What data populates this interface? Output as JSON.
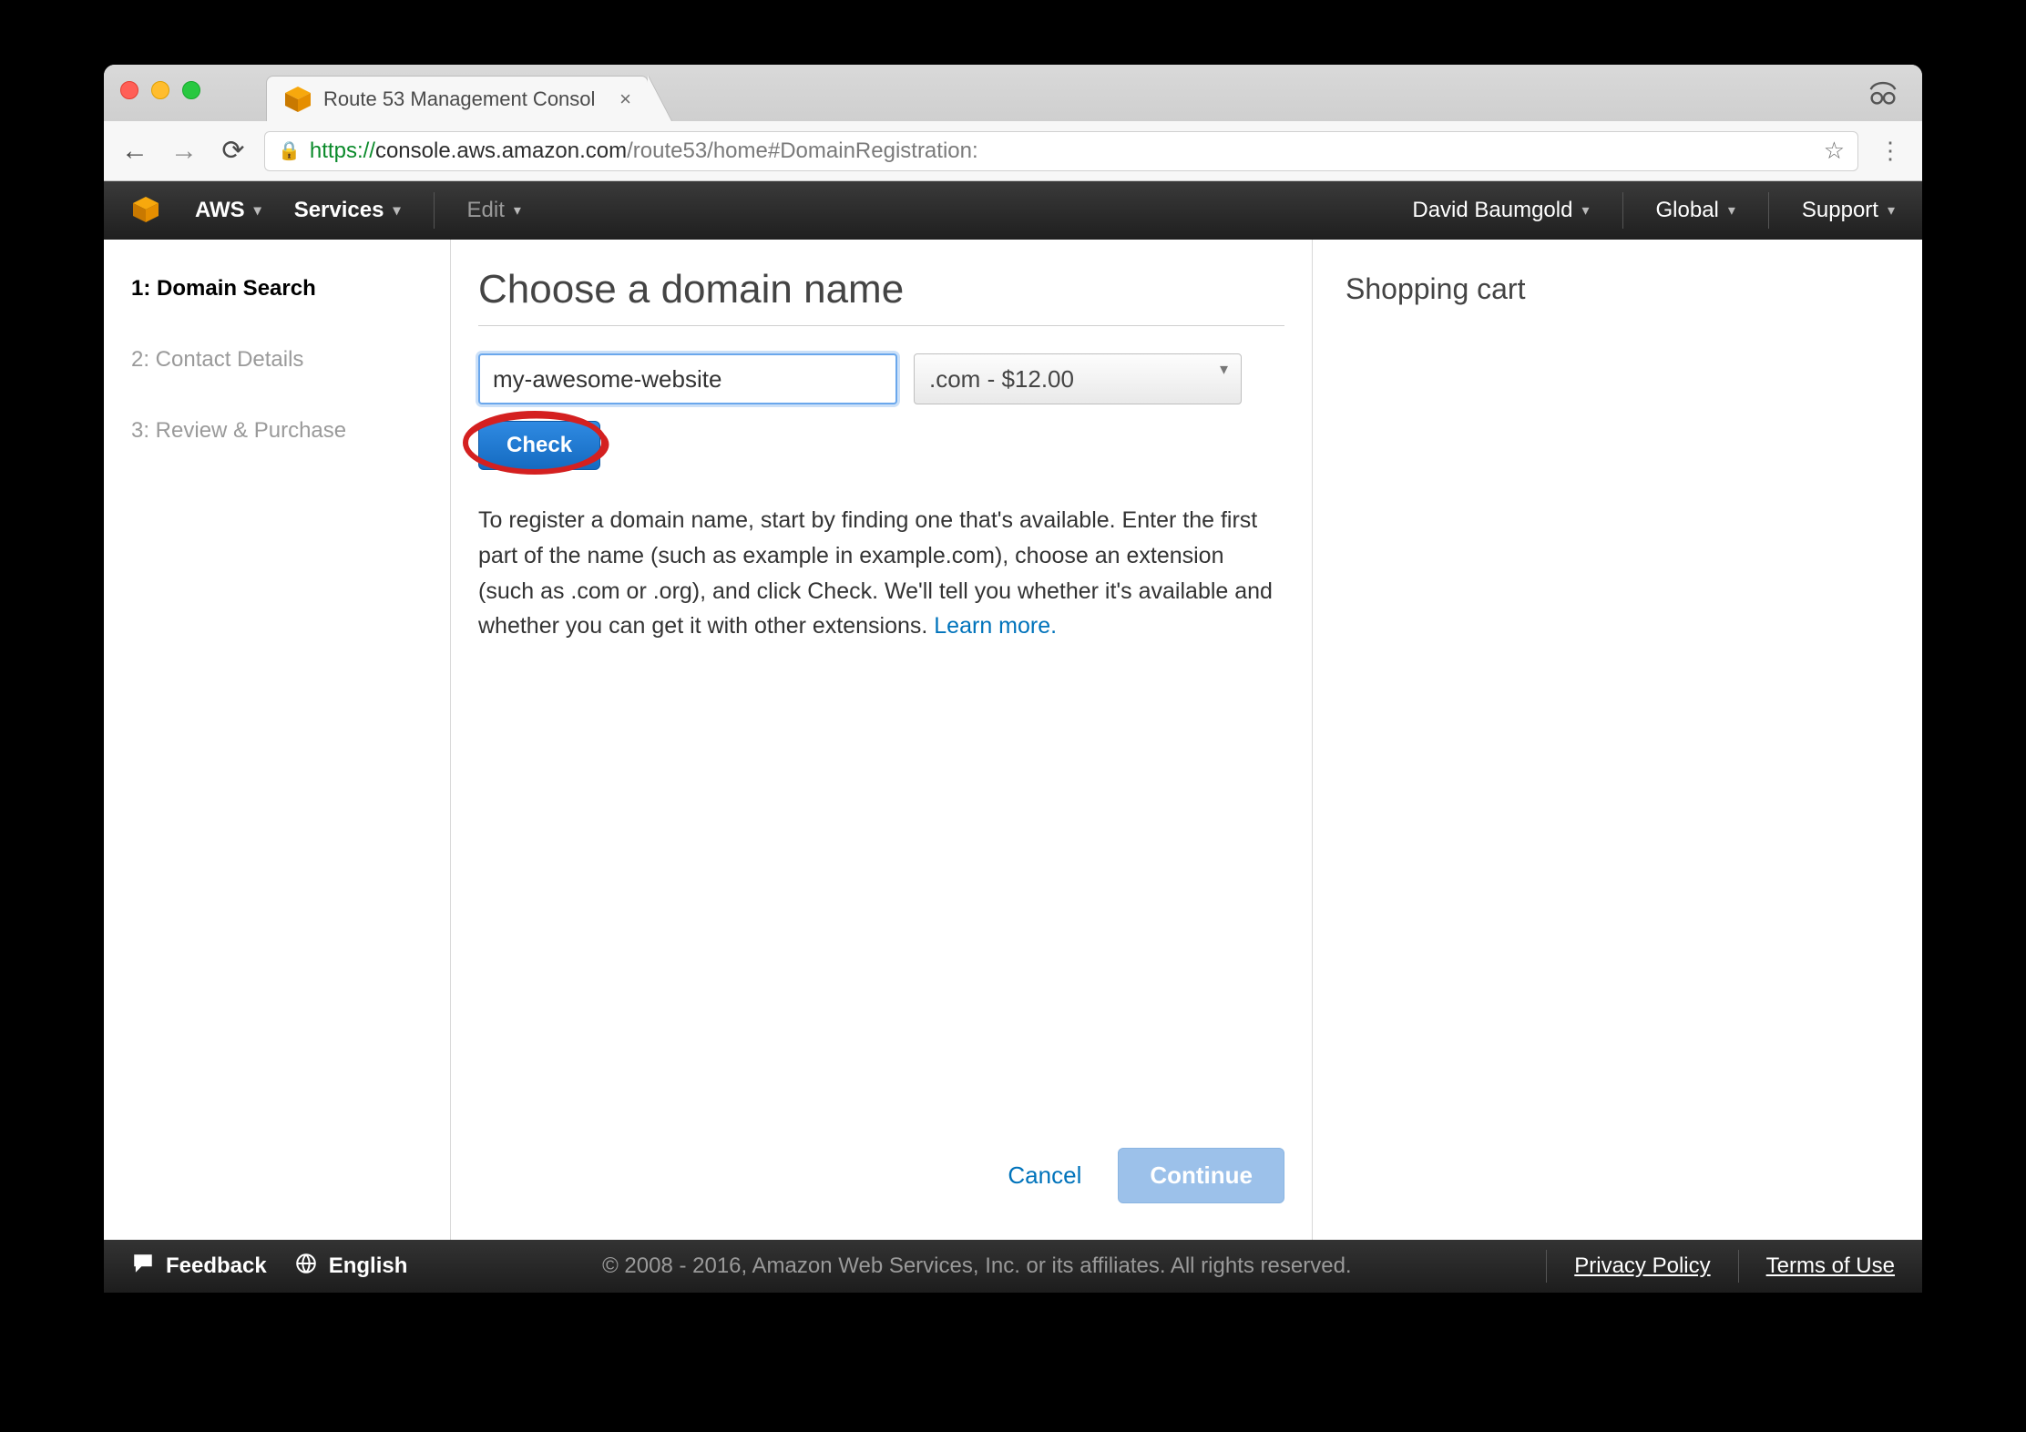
{
  "browser": {
    "tab_title": "Route 53 Management Consol",
    "url_proto": "https://",
    "url_host": "console.aws.amazon.com",
    "url_path": "/route53/home#DomainRegistration:"
  },
  "nav": {
    "aws": "AWS",
    "services": "Services",
    "edit": "Edit",
    "user": "David Baumgold",
    "region": "Global",
    "support": "Support"
  },
  "sidebar": {
    "steps": [
      {
        "label": "1: Domain Search",
        "active": true
      },
      {
        "label": "2: Contact Details",
        "active": false
      },
      {
        "label": "3: Review & Purchase",
        "active": false
      }
    ]
  },
  "main": {
    "title": "Choose a domain name",
    "input_value": "my-awesome-website",
    "tld_selected": ".com - $12.00",
    "check_label": "Check",
    "blurb_text": "To register a domain name, start by finding one that's available. Enter the first part of the name (such as example in example.com), choose an extension (such as .com or .org), and click Check. We'll tell you whether it's available and whether you can get it with other extensions.  ",
    "learn_more": "Learn more.",
    "cancel": "Cancel",
    "continue": "Continue"
  },
  "cart": {
    "title": "Shopping cart"
  },
  "footer": {
    "feedback": "Feedback",
    "language": "English",
    "copyright": "© 2008 - 2016, Amazon Web Services, Inc. or its affiliates. All rights reserved.",
    "privacy": "Privacy Policy",
    "terms": "Terms of Use"
  }
}
